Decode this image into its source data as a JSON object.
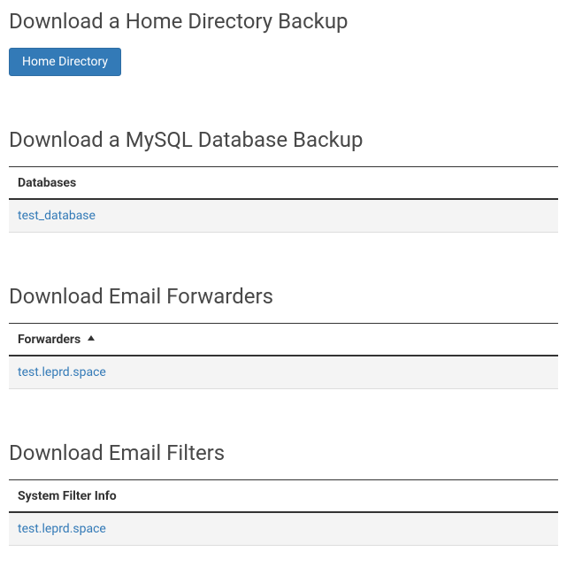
{
  "home_backup": {
    "title": "Download a Home Directory Backup",
    "button_label": "Home Directory"
  },
  "mysql_backup": {
    "title": "Download a MySQL Database Backup",
    "header": "Databases",
    "rows": [
      {
        "name": "test_database"
      }
    ]
  },
  "email_forwarders": {
    "title": "Download Email Forwarders",
    "header": "Forwarders",
    "sort_direction": "asc",
    "rows": [
      {
        "name": "test.leprd.space"
      }
    ]
  },
  "email_filters": {
    "title": "Download Email Filters",
    "header": "System Filter Info",
    "rows": [
      {
        "name": "test.leprd.space"
      }
    ]
  }
}
